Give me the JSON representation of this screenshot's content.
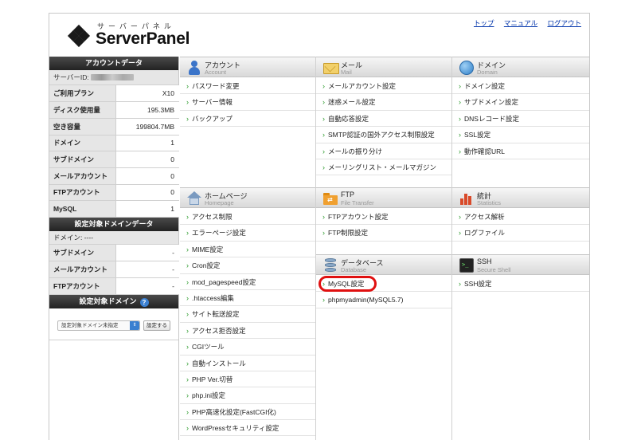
{
  "header": {
    "logo_kana": "サーバーパネル",
    "logo_name": "ServerPanel",
    "links": [
      "トップ",
      "マニュアル",
      "ログアウト"
    ]
  },
  "sidebar": {
    "account_title": "アカウントデータ",
    "server_id_label": "サーバーID:",
    "stats": [
      {
        "label": "ご利用プラン",
        "value": "X10"
      },
      {
        "label": "ディスク使用量",
        "value": "195.3MB"
      },
      {
        "label": "空き容量",
        "value": "199804.7MB"
      },
      {
        "label": "ドメイン",
        "value": "1"
      },
      {
        "label": "サブドメイン",
        "value": "0"
      },
      {
        "label": "メールアカウント",
        "value": "0"
      },
      {
        "label": "FTPアカウント",
        "value": "0"
      },
      {
        "label": "MySQL",
        "value": "1"
      }
    ],
    "domain_data_title": "設定対象ドメインデータ",
    "domain_line": "ドメイン: ----",
    "domain_stats": [
      {
        "label": "サブドメイン",
        "value": "-"
      },
      {
        "label": "メールアカウント",
        "value": "-"
      },
      {
        "label": "FTPアカウント",
        "value": "-"
      }
    ],
    "target_domain_title": "設定対象ドメイン",
    "select_value": "設定対象ドメイン未指定",
    "set_button": "設定する"
  },
  "sections": {
    "account": {
      "title": "アカウント",
      "sub": "Account",
      "items": [
        "パスワード変更",
        "サーバー情報",
        "バックアップ"
      ]
    },
    "mail": {
      "title": "メール",
      "sub": "Mail",
      "items": [
        "メールアカウント設定",
        "迷惑メール設定",
        "自動応答設定",
        "SMTP認証の国外アクセス制限設定",
        "メールの振り分け",
        "メーリングリスト・メールマガジン"
      ]
    },
    "domain": {
      "title": "ドメイン",
      "sub": "Domain",
      "items": [
        "ドメイン設定",
        "サブドメイン設定",
        "DNSレコード設定",
        "SSL設定",
        "動作確認URL"
      ]
    },
    "homepage": {
      "title": "ホームページ",
      "sub": "Homepage",
      "items": [
        "アクセス制限",
        "エラーページ設定",
        "MIME設定",
        "Cron設定",
        "mod_pagespeed設定",
        ".htaccess編集",
        "サイト転送設定",
        "アクセス拒否設定",
        "CGIツール",
        "自動インストール",
        "PHP Ver.切替",
        "php.ini設定",
        "PHP高速化設定(FastCGI化)",
        "WordPressセキュリティ設定"
      ]
    },
    "ftp": {
      "title": "FTP",
      "sub": "File Transfer",
      "items": [
        "FTPアカウント設定",
        "FTP制限設定"
      ]
    },
    "stats": {
      "title": "統計",
      "sub": "Statistics",
      "items": [
        "アクセス解析",
        "ログファイル"
      ]
    },
    "database": {
      "title": "データベース",
      "sub": "Database",
      "items": [
        "MySQL設定",
        "phpmyadmin(MySQL5.7)"
      ]
    },
    "ssh": {
      "title": "SSH",
      "sub": "Secure Shell",
      "items": [
        "SSH設定"
      ]
    }
  },
  "colors": {
    "highlight": "#e01010",
    "chevron": "#2a9a2a",
    "link": "#0033aa"
  }
}
